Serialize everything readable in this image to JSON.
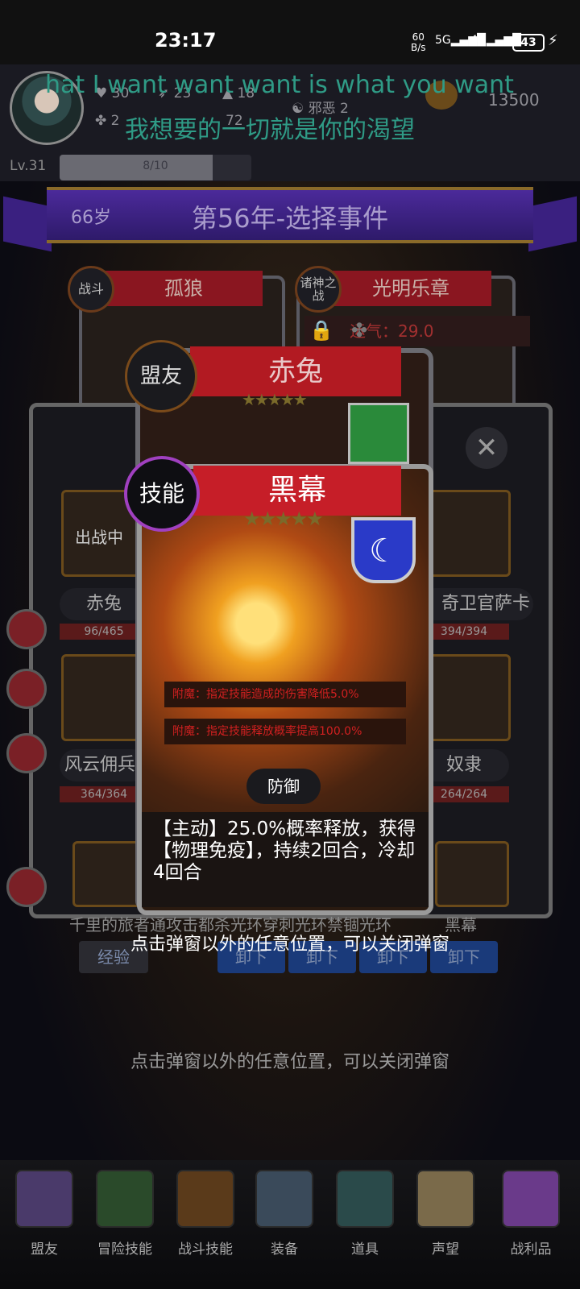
{
  "status_bar": {
    "time": "23:17",
    "net_speed": "60",
    "net_unit": "B/s",
    "sig1": "5G",
    "sig2": "4G",
    "battery": "43"
  },
  "player": {
    "stats": [
      "30",
      "23",
      "18",
      "邪恶 2",
      "13500",
      "2",
      "72"
    ],
    "level": "Lv.31",
    "exp": "8/10",
    "exp_fraction": 0.8
  },
  "lyrics": {
    "line1": "hat I want want want is what you want",
    "line2": "我想要的一切就是你的渴望"
  },
  "event": {
    "age": "66岁",
    "title": "第56年-选择事件"
  },
  "cards": {
    "left": {
      "tag": "战斗",
      "name": "孤狼"
    },
    "right": {
      "tag": "诸神之战",
      "name": "光明乐章"
    },
    "luck": "运气：29.0"
  },
  "panel": {
    "slots": [
      {
        "name": "赤兔",
        "hp": "96/465",
        "badge": "出战中"
      },
      {
        "name": "奇卫官萨卡",
        "hp": "394/394"
      },
      {
        "name": "风云佣兵",
        "hp": "364/364"
      },
      {
        "name": "奴隶",
        "hp": "264/264"
      }
    ],
    "bottom_row_text": "千里的旅者通攻击都杀光环穿刺光环禁锢光环",
    "bottom_row_right": "黑幕",
    "btn_left": "经验",
    "btn_labels": [
      "卸下",
      "卸下",
      "卸下",
      "卸下"
    ]
  },
  "ally_card": {
    "tag": "盟友",
    "name": "赤兔"
  },
  "skill_card": {
    "tag": "技能",
    "name": "黑幕",
    "enchant1": "附魔：指定技能造成的伤害降低5.0%",
    "enchant2": "附魔：指定技能释放概率提高100.0%",
    "type": "防御",
    "description": "【主动】25.0%概率释放，获得【物理免疫】，持续2回合，冷却4回合"
  },
  "hints": {
    "close_hint": "点击弹窗以外的任意位置，可以关闭弹窗"
  },
  "nav": [
    "盟友",
    "冒险技能",
    "战斗技能",
    "装备",
    "道具",
    "声望",
    "战利品"
  ]
}
